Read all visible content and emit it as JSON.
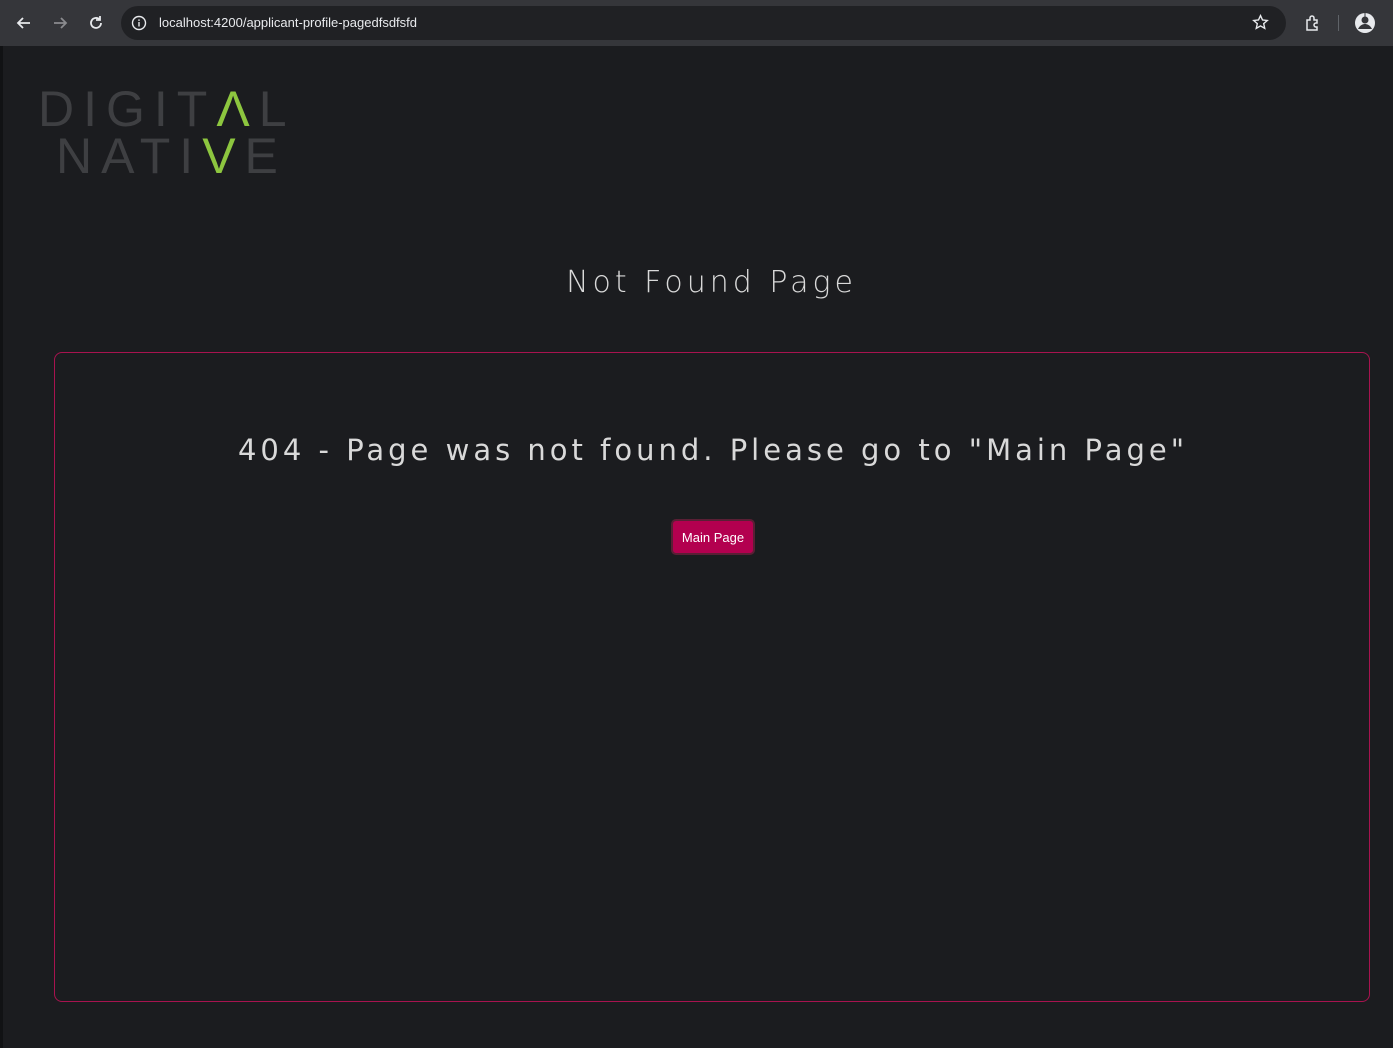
{
  "browser": {
    "url": "localhost:4200/applicant-profile-pagedfsdfsfd"
  },
  "logo": {
    "line1_main": "DIGIT",
    "line1_accent": "Λ",
    "line1_end": "L",
    "line2_main": "NATI",
    "line2_accent": "V",
    "line2_end": "E",
    "accent_color": "#8dc63f"
  },
  "page": {
    "title": "Not Found Page",
    "message": "404 - Page was not found. Please go to \"Main Page\"",
    "button_label": "Main Page"
  },
  "colors": {
    "background": "#1b1c1f",
    "panel_border": "#a8134f",
    "button": "#b3004f"
  }
}
